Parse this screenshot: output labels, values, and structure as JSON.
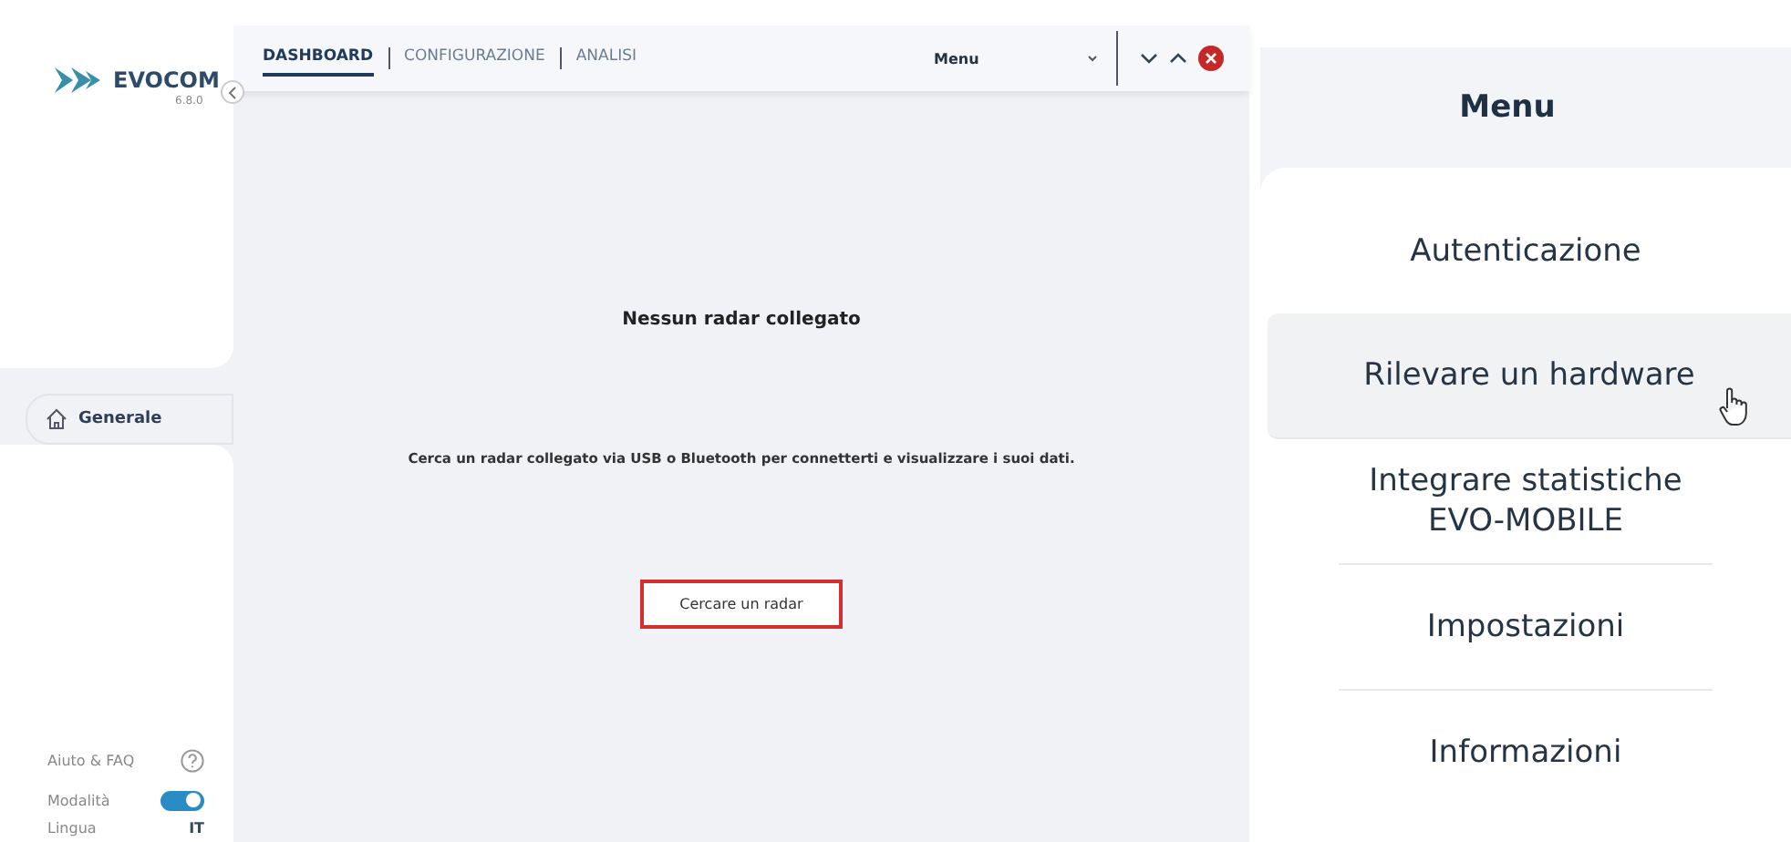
{
  "app": {
    "logo": "EVOCOM",
    "version": "6.8.0",
    "nav": [
      {
        "label": "Generale",
        "selected": true
      }
    ],
    "footer": {
      "help": "Aiuto & FAQ",
      "mode": {
        "label": "Modalità",
        "on": true
      },
      "language": {
        "label": "Lingua",
        "value": "IT"
      }
    },
    "tabs": [
      {
        "label": "DASHBOARD",
        "selected": true
      },
      {
        "label": "CONFIGURAZIONE",
        "selected": false
      },
      {
        "label": "ANALISI",
        "selected": false
      }
    ],
    "menu_select": "Menu",
    "content": {
      "title": "Nessun radar collegato",
      "text": "Cerca un radar collegato via USB o Bluetooth per connetterti e visualizzare i suoi dati.",
      "button": "Cercare un radar"
    }
  },
  "menu_panel": {
    "title": "Menu",
    "items": [
      {
        "label": "Autenticazione",
        "selected": false
      },
      {
        "label": "Rilevare un hardware",
        "selected": true
      },
      {
        "label": "Integrare statistiche EVO-MOBILE",
        "selected": false
      },
      {
        "label": "Impostazioni",
        "selected": false
      },
      {
        "label": "Informazioni",
        "selected": false
      }
    ]
  }
}
